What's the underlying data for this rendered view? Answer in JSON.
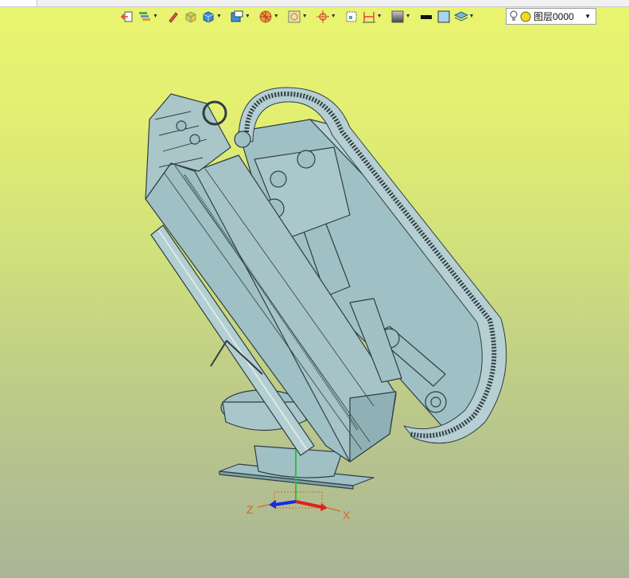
{
  "toolbar": {
    "layer": {
      "label": "图层0000",
      "bulb_icon": "lightbulb-icon",
      "status_icon": "yellow-circle-icon"
    }
  },
  "axes": {
    "x_label": "X",
    "z_label": "Z"
  },
  "colors": {
    "model_fill": "#9fc0c4",
    "model_edge": "#2f3e44",
    "bg_top": "#eaf470",
    "bg_bottom": "#a9b597",
    "axis_x": "#e0201a",
    "axis_y": "#2ec03a",
    "axis_z": "#1a2ae0"
  }
}
